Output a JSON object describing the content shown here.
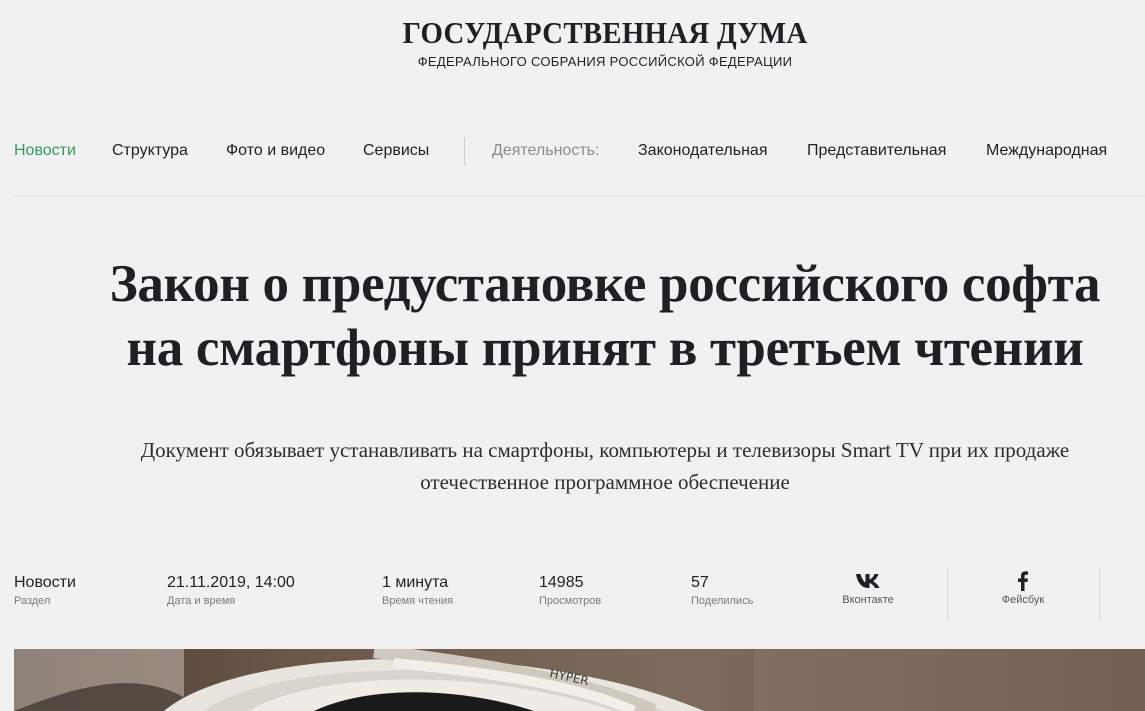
{
  "logo": {
    "title": "ГОСУДАРСТВЕННАЯ ДУМА",
    "subtitle": "ФЕДЕРАЛЬНОГО СОБРАНИЯ РОССИЙСКОЙ ФЕДЕРАЦИИ"
  },
  "nav": {
    "items": [
      "Новости",
      "Структура",
      "Фото и видео",
      "Сервисы"
    ],
    "activity_label": "Деятельность:",
    "activity_items": [
      "Законодательная",
      "Представительная",
      "Международная"
    ]
  },
  "article": {
    "headline_line1": "Закон о предустановке российского софта",
    "headline_line2": "на смартфоны принят в третьем чтении",
    "lead_line1": "Документ обязывает устанавливать на смартфоны, компьютеры и телевизоры Smart TV при их продаже",
    "lead_line2": "отечественное программное обеспечение"
  },
  "meta": {
    "section": {
      "value": "Новости",
      "label": "Раздел"
    },
    "datetime": {
      "value": "21.11.2019, 14:00",
      "label": "Дата и время"
    },
    "reading": {
      "value": "1 минута",
      "label": "Время чтения"
    },
    "views": {
      "value": "14985",
      "label": "Просмотров"
    },
    "shares": {
      "value": "57",
      "label": "Поделились"
    }
  },
  "share": {
    "vk": {
      "label": "Вконтакте",
      "icon": "vk-icon"
    },
    "fb": {
      "label": "Фейсбук",
      "icon": "facebook-icon"
    }
  },
  "photo": {
    "cable_text": "HYPER"
  },
  "colors": {
    "background": "#f1f1f1",
    "text": "#1e2023",
    "accent": "#2e9e5a",
    "muted": "#8c8c8c"
  }
}
